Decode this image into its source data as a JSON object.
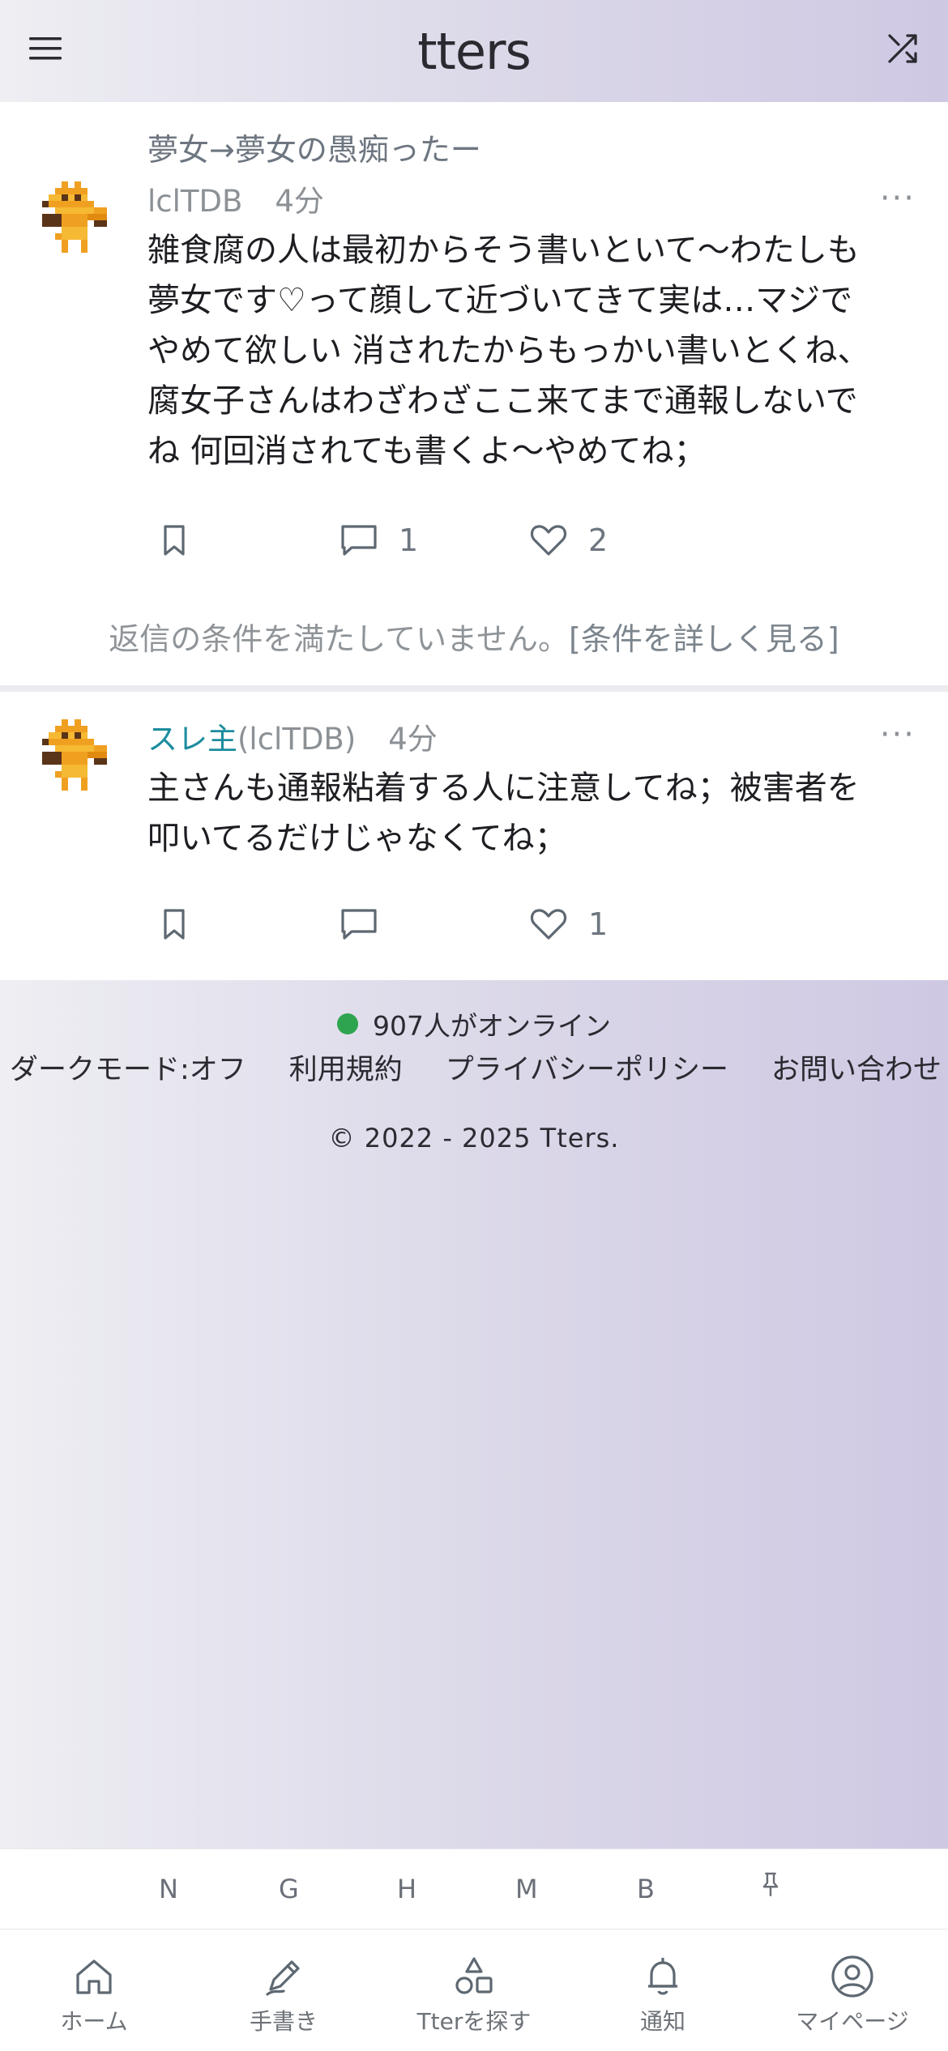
{
  "header": {
    "logo": "tters"
  },
  "posts": [
    {
      "category": "夢女→夢女の愚痴ったー",
      "author": "lclTDB",
      "time": "4分",
      "body": "雑食腐の人は最初からそう書いといて〜わたしも夢女です♡って顔して近づいてきて実は…マジでやめて欲しい 消されたからもっかい書いとくね、腐女子さんはわざわざここ来てまで通報しないでね 何回消されても書くよ〜やめてね；",
      "comments": "1",
      "likes": "2",
      "notice": "返信の条件を満たしていません。",
      "notice_link": "[条件を詳しく見る]"
    },
    {
      "author_accent": "スレ主",
      "author": "(lclTDB)",
      "time": "4分",
      "body": "主さんも通報粘着する人に注意してね；被害者を叩いてるだけじゃなくてね；",
      "likes": "1"
    }
  ],
  "footer": {
    "online": "907人がオンライン",
    "links": [
      "ダークモード:オフ",
      "利用規約",
      "プライバシーポリシー",
      "お問い合わせ"
    ],
    "copyright": "© 2022 - 2025 Tters."
  },
  "shortcuts": [
    "N",
    "G",
    "H",
    "M",
    "B"
  ],
  "nav": [
    {
      "label": "ホーム",
      "icon": "home-icon"
    },
    {
      "label": "手書き",
      "icon": "pen-icon"
    },
    {
      "label": "Tterを探す",
      "icon": "shapes-icon"
    },
    {
      "label": "通知",
      "icon": "bell-icon"
    },
    {
      "label": "マイページ",
      "icon": "user-circle-icon"
    }
  ],
  "colors": {
    "accent": "#1c8c9e",
    "online": "#2ea44f",
    "avatar_orange": "#f0a020",
    "avatar_brown": "#5a3418"
  }
}
